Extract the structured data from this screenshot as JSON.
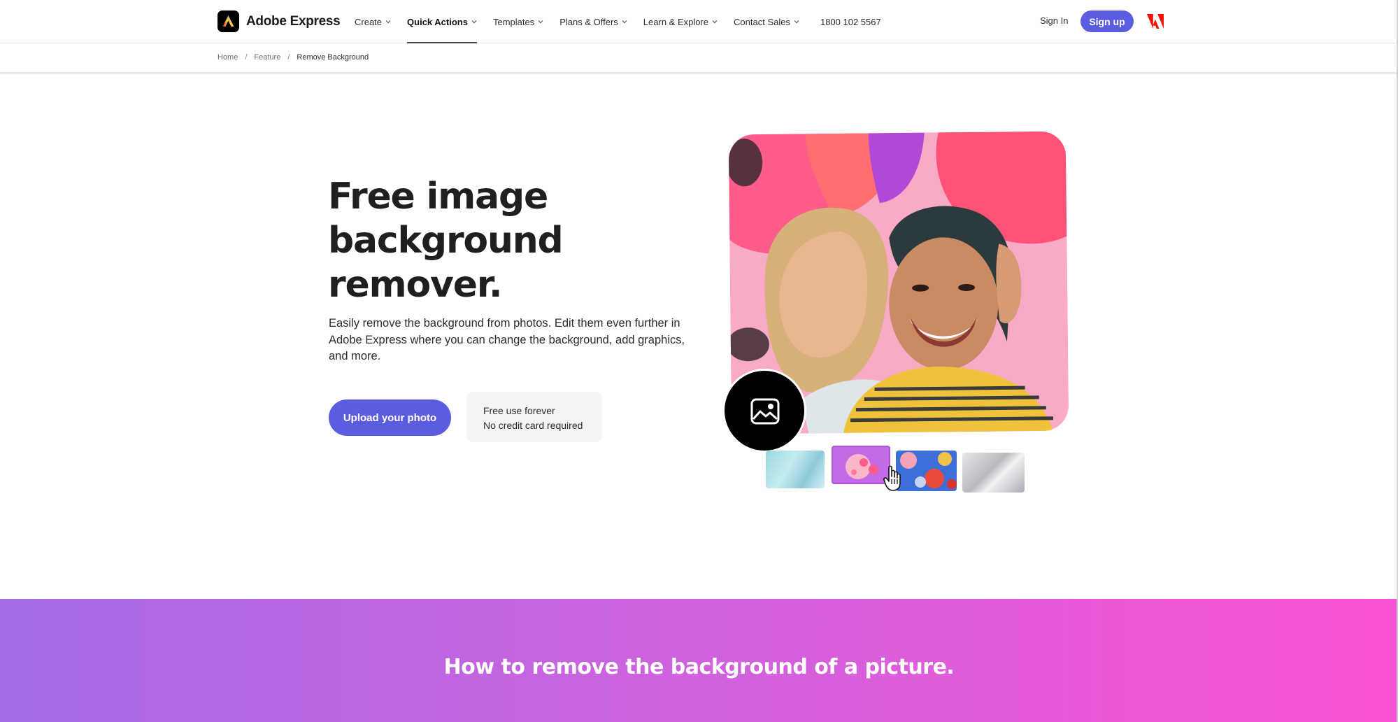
{
  "brand": {
    "name": "Adobe Express"
  },
  "nav": {
    "items": [
      {
        "label": "Create",
        "active": false
      },
      {
        "label": "Quick Actions",
        "active": true
      },
      {
        "label": "Templates",
        "active": false
      },
      {
        "label": "Plans & Offers",
        "active": false
      },
      {
        "label": "Learn & Explore",
        "active": false
      },
      {
        "label": "Contact Sales",
        "active": false
      }
    ],
    "phone": "1800 102 5567",
    "signin_label": "Sign In",
    "signup_label": "Sign up"
  },
  "breadcrumb": {
    "items": [
      "Home",
      "Feature"
    ],
    "separator": "/",
    "current": "Remove Background"
  },
  "hero": {
    "title_lines": [
      "Free image",
      "background",
      "remover."
    ],
    "description": "Easily remove the background from photos. Edit them even further in Adobe Express where you can change the background, add graphics, and more.",
    "upload_label": "Upload your photo",
    "free_line1": "Free use forever",
    "free_line2": "No credit card required"
  },
  "banner": {
    "title": "How to remove the background of a picture."
  },
  "colors": {
    "accent": "#5c5ce0",
    "banner_start": "#a46ae4",
    "banner_end": "#fd52d6",
    "adobe_red": "#fa0f00"
  },
  "icons": [
    "adobe-express-logo-icon",
    "chevron-down-icon",
    "adobe-logo-icon",
    "image-icon",
    "hand-cursor-icon"
  ]
}
